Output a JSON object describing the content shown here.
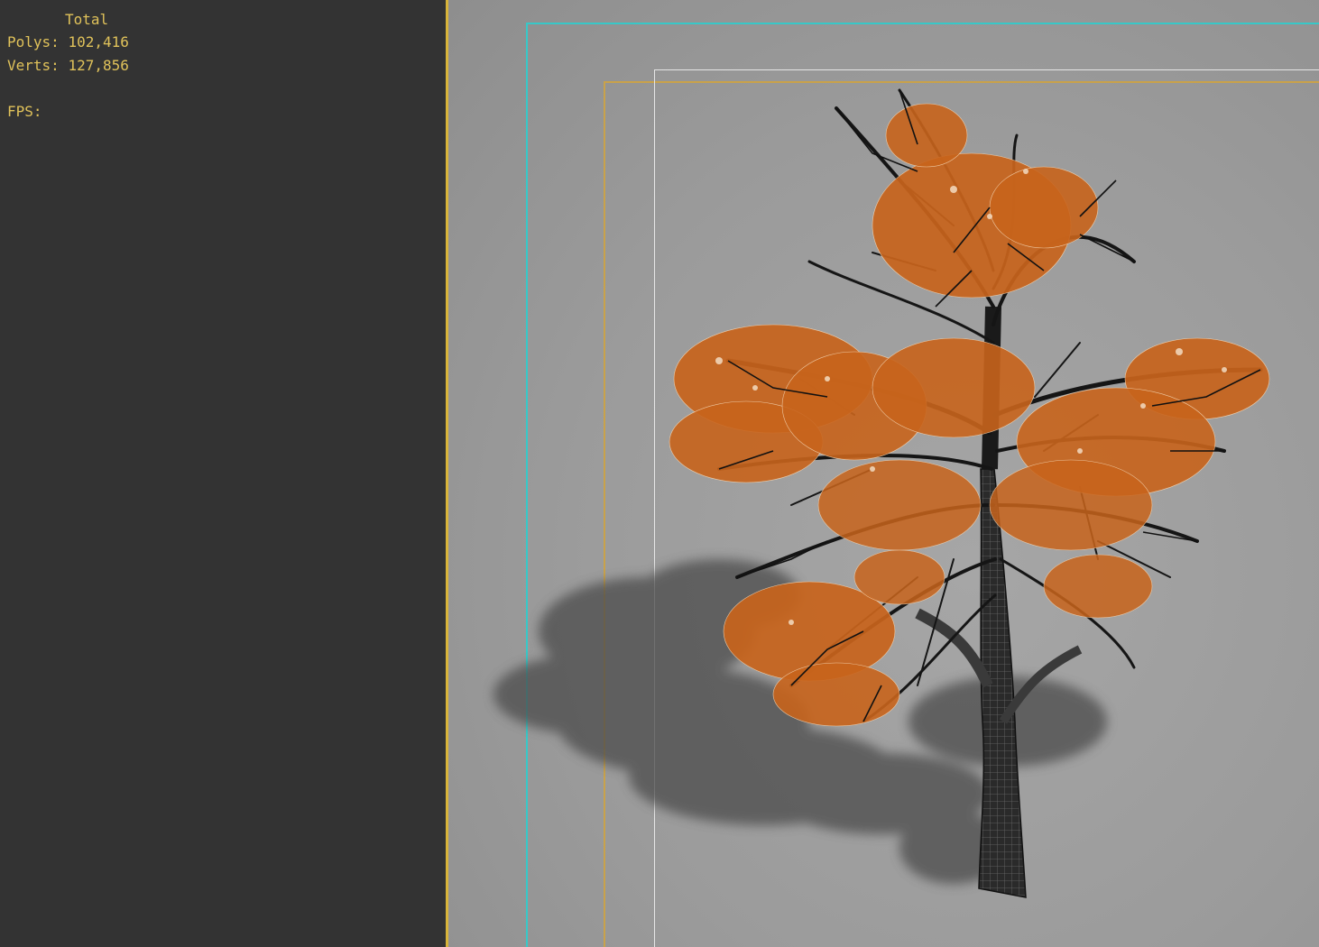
{
  "stats": {
    "header": "Total",
    "polys_label": "Polys:",
    "polys_value": "102,416",
    "verts_label": "Verts:",
    "verts_value": "127,856",
    "fps_label": "FPS:"
  },
  "colors": {
    "panel_bg": "#333333",
    "stat_text": "#e0c25a",
    "viewport_bg": "#9b9b9b",
    "safe_frame": "#37c8c8",
    "action_frame": "#c9a24a",
    "render_frame": "#e6e6e6",
    "foliage": "#c8641c",
    "branches": "#151515",
    "shadow": "#4a4a4a"
  },
  "viewport": {
    "content": "tree-wireframe-icon"
  }
}
